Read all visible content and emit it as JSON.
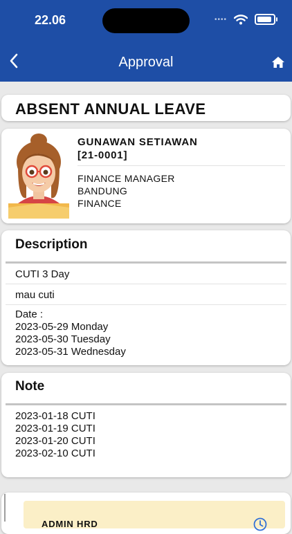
{
  "status_bar": {
    "time": "22.06"
  },
  "header": {
    "title": "Approval"
  },
  "leave": {
    "title": "ABSENT ANNUAL LEAVE"
  },
  "employee": {
    "name": "GUNAWAN SETIAWAN",
    "id": "[21-0001]",
    "position": "FINANCE MANAGER",
    "location": "BANDUNG",
    "department": "FINANCE"
  },
  "description": {
    "heading": "Description",
    "cuti_line": "CUTI  3  Day",
    "reason": "mau cuti",
    "date_label": "Date  :",
    "dates": [
      "2023-05-29  Monday",
      "2023-05-30  Tuesday",
      "2023-05-31  Wednesday"
    ]
  },
  "note": {
    "heading": "Note",
    "items": [
      "2023-01-18    CUTI",
      "2023-01-19    CUTI",
      "2023-01-20    CUTI",
      "2023-02-10    CUTI"
    ]
  },
  "approval": {
    "approver": "ADMIN HRD",
    "status_icon": "clock-icon"
  },
  "colors": {
    "header_bg": "#1e4ea6",
    "approval_bg": "#fbefc7",
    "clock": "#2f6fd6"
  }
}
